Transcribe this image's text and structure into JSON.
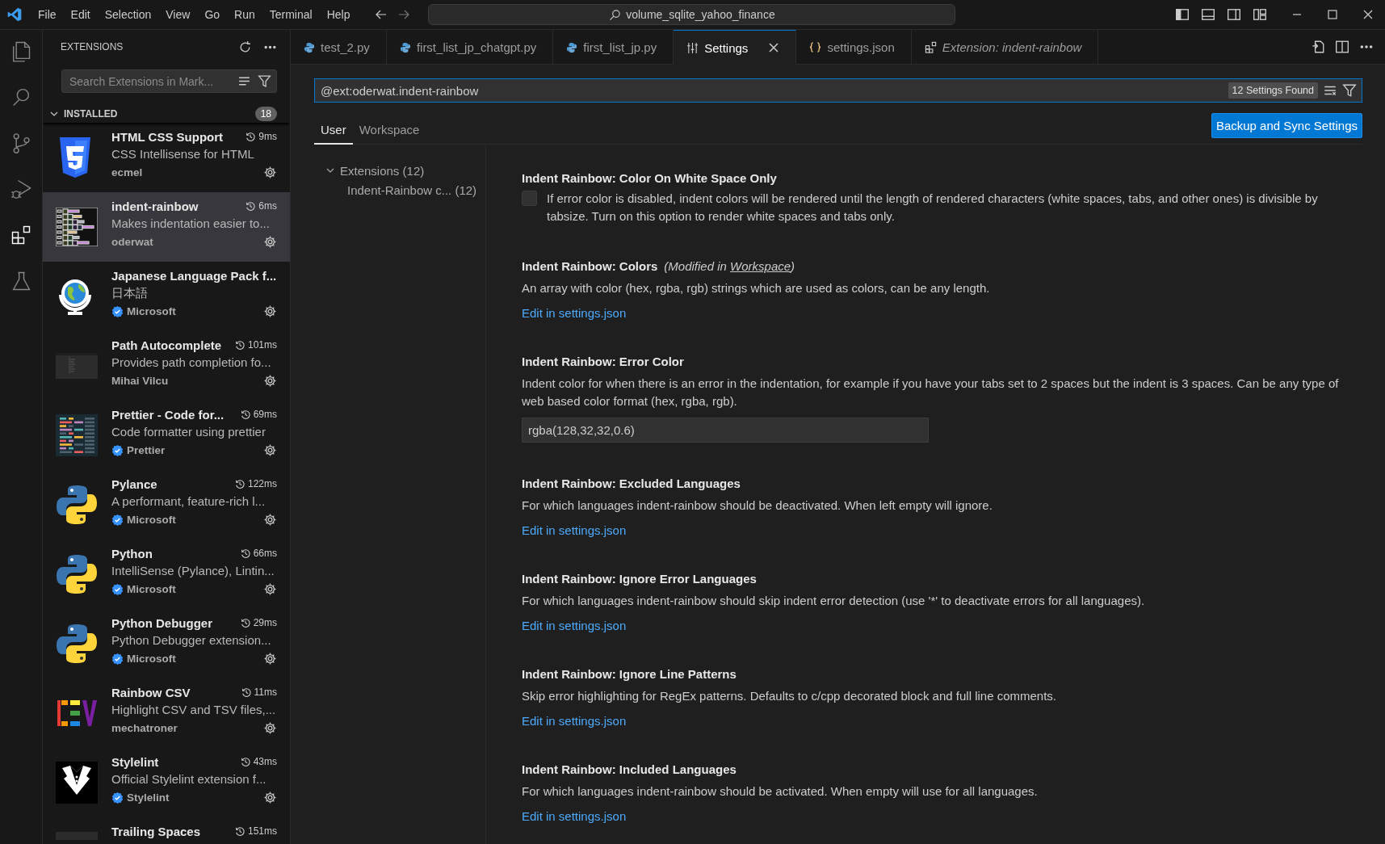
{
  "menu": [
    "File",
    "Edit",
    "Selection",
    "View",
    "Go",
    "Run",
    "Terminal",
    "Help"
  ],
  "command_center": "volume_sqlite_yahoo_finance",
  "activity_bar": [
    {
      "kind": "explorer",
      "selected": false
    },
    {
      "kind": "search",
      "selected": false
    },
    {
      "kind": "scm",
      "selected": false
    },
    {
      "kind": "debug",
      "selected": false
    },
    {
      "kind": "extensions",
      "selected": true
    },
    {
      "kind": "testing",
      "selected": false
    }
  ],
  "sidebar": {
    "title": "EXTENSIONS",
    "search": {
      "placeholder": "Search Extensions in Mark..."
    },
    "section": {
      "title": "INSTALLED",
      "count": "18",
      "expanded": true
    },
    "extensions": [
      {
        "name": "HTML CSS Support",
        "time": "9ms",
        "description": "CSS Intellisense for HTML",
        "publisher": "ecmel",
        "verified": false,
        "selected": false,
        "kind": "css"
      },
      {
        "name": "indent-rainbow",
        "time": "6ms",
        "description": "Makes indentation easier to...",
        "publisher": "oderwat",
        "verified": false,
        "selected": true,
        "kind": "code"
      },
      {
        "name": "Japanese Language Pack f...",
        "description": "日本語",
        "publisher": "Microsoft",
        "verified": true,
        "selected": false,
        "kind": "globe"
      },
      {
        "name": "Path Autocomplete",
        "time": "101ms",
        "description": "Provides path completion fo...",
        "publisher": "Mihai Vilcu",
        "verified": false,
        "selected": false,
        "kind": "screen"
      },
      {
        "name": "Prettier - Code for...",
        "time": "69ms",
        "description": "Code formatter using prettier",
        "publisher": "Prettier",
        "verified": true,
        "selected": false,
        "kind": "prettier"
      },
      {
        "name": "Pylance",
        "time": "122ms",
        "description": "A performant, feature-rich l...",
        "publisher": "Microsoft",
        "verified": true,
        "selected": false,
        "kind": "python"
      },
      {
        "name": "Python",
        "time": "66ms",
        "description": "IntelliSense (Pylance), Lintin...",
        "publisher": "Microsoft",
        "verified": true,
        "selected": false,
        "kind": "python"
      },
      {
        "name": "Python Debugger",
        "time": "29ms",
        "description": "Python Debugger extension...",
        "publisher": "Microsoft",
        "verified": true,
        "selected": false,
        "kind": "python"
      },
      {
        "name": "Rainbow CSV",
        "time": "11ms",
        "description": "Highlight CSV and TSV files,...",
        "publisher": "mechatroner",
        "verified": false,
        "selected": false,
        "kind": "csv"
      },
      {
        "name": "Stylelint",
        "time": "43ms",
        "description": "Official Stylelint extension f...",
        "publisher": "Stylelint",
        "verified": true,
        "selected": false,
        "kind": "tuxedo"
      },
      {
        "name": "Trailing Spaces",
        "time": "151ms",
        "selected": false,
        "kind": "dark"
      }
    ]
  },
  "tabs": [
    {
      "label": "test_2.py",
      "kind": "python",
      "selected": false,
      "preview": false
    },
    {
      "label": "first_list_jp_chatgpt.py",
      "kind": "python",
      "selected": false,
      "preview": false
    },
    {
      "label": "first_list_jp.py",
      "kind": "python",
      "selected": false,
      "preview": false
    },
    {
      "label": "Settings",
      "kind": "settings",
      "selected": true,
      "preview": false
    },
    {
      "label": "settings.json",
      "kind": "json",
      "selected": false,
      "preview": false
    },
    {
      "label": "Extension: indent-rainbow",
      "kind": "extension",
      "selected": false,
      "preview": true
    }
  ],
  "settings": {
    "search": {
      "value": "@ext:oderwat.indent-rainbow",
      "count": "12 Settings Found"
    },
    "scope_tabs": [
      {
        "label": "User",
        "selected": true
      },
      {
        "label": "Workspace",
        "selected": false
      }
    ],
    "sync_button": "Backup and Sync Settings",
    "toc": [
      {
        "label": "Extensions",
        "count": "(12)",
        "expanded": true,
        "children": [
          {
            "label": "Indent-Rainbow c...",
            "count": "(12)"
          }
        ]
      }
    ],
    "items": [
      {
        "kind": "checkbox",
        "category": "Indent Rainbow:",
        "title": "Color On White Space Only",
        "description": "If error color is disabled, indent colors will be rendered until the length of rendered characters (white spaces, tabs, and other ones) is divisible by tabsize. Turn on this option to render white spaces and tabs only.",
        "checked": false
      },
      {
        "kind": "link",
        "category": "Indent Rainbow:",
        "title": "Colors",
        "modified": {
          "before": "(Modified in",
          "link": "Workspace",
          "after": ")"
        },
        "description": "An array with color (hex, rgba, rgb) strings which are used as colors, can be any length.",
        "link": "Edit in settings.json"
      },
      {
        "kind": "text",
        "category": "Indent Rainbow:",
        "title": "Error Color",
        "description": "Indent color for when there is an error in the indentation, for example if you have your tabs set to 2 spaces but the indent is 3 spaces. Can be any type of web based color format (hex, rgba, rgb).",
        "value": "rgba(128,32,32,0.6)"
      },
      {
        "kind": "link",
        "category": "Indent Rainbow:",
        "title": "Excluded Languages",
        "description": "For which languages indent-rainbow should be deactivated. When left empty will ignore.",
        "link": "Edit in settings.json"
      },
      {
        "kind": "link",
        "category": "Indent Rainbow:",
        "title": "Ignore Error Languages",
        "description": "For which languages indent-rainbow should skip indent error detection (use '*' to deactivate errors for all languages).",
        "link": "Edit in settings.json"
      },
      {
        "kind": "link",
        "category": "Indent Rainbow:",
        "title": "Ignore Line Patterns",
        "description": "Skip error highlighting for RegEx patterns. Defaults to c/cpp decorated block and full line comments.",
        "link": "Edit in settings.json"
      },
      {
        "kind": "link",
        "category": "Indent Rainbow:",
        "title": "Included Languages",
        "description": "For which languages indent-rainbow should be activated. When empty will use for all languages.",
        "link": "Edit in settings.json"
      }
    ]
  }
}
